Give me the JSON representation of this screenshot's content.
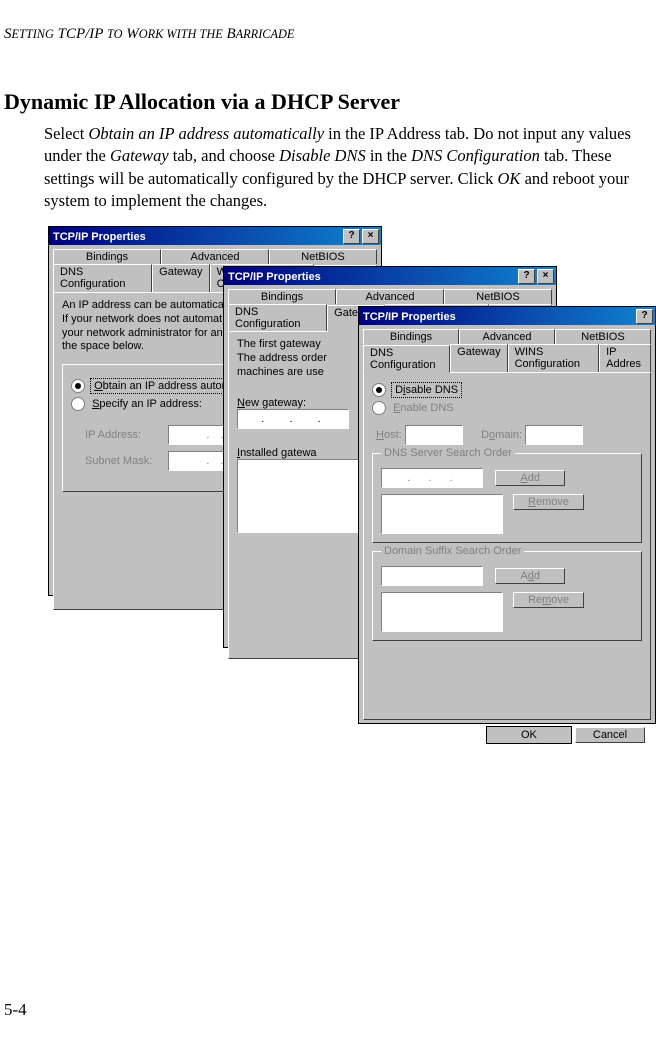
{
  "running_head": "Setting TCP/IP to Work with the Barricade",
  "section_title": "Dynamic IP Allocation via a DHCP Server",
  "body_html": "Select <em>Obtain an IP address automatically</em> in the IP Address tab. Do not input any values under the <em>Gateway</em> tab, and choose <em>Disable DNS</em> in the <em>DNS Configuration</em> tab. These settings will be automatically configured by the DHCP server. Click <em>OK</em> and reboot your system to implement the changes.",
  "page_number": "5-4",
  "win_title": "TCP/IP Properties",
  "tabs_row1": {
    "bindings": "Bindings",
    "advanced": "Advanced",
    "netbios": "NetBIOS"
  },
  "tabs_row2": {
    "dns": "DNS Configuration",
    "gateway": "Gateway",
    "wins": "WINS Configuration",
    "ip": "IP Address"
  },
  "ip_panel": {
    "note1": "An IP address can be automatically assig",
    "note2": "If your network does not automatically as",
    "note3": "your network administrator for an address",
    "note4": "the space below.",
    "radio_obtain": "Obtain an IP address automatically",
    "radio_specify": "Specify an IP address:",
    "label_ip": "IP Address:",
    "label_subnet": "Subnet Mask:"
  },
  "gw_panel": {
    "note1": "The first gateway",
    "note2": "The address order",
    "note3": "machines are use",
    "label_new": "New gateway:",
    "label_installed": "Installed gatewa"
  },
  "dns_panel": {
    "radio_disable": "Disable DNS",
    "radio_enable": "Enable DNS",
    "label_host": "Host:",
    "label_domain": "Domain:",
    "fs_server": "DNS Server Search Order",
    "fs_suffix": "Domain Suffix Search Order",
    "btn_add": "Add",
    "btn_remove": "Remove"
  },
  "buttons": {
    "ok": "OK",
    "cancel": "Cancel",
    "help": "?",
    "close": "×"
  },
  "ip_dots": ".   .   ."
}
